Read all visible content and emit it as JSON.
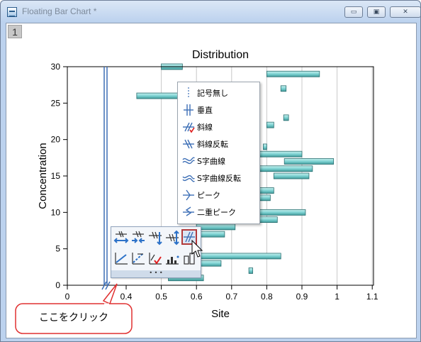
{
  "window": {
    "title": "Floating Bar Chart *",
    "buttons": {
      "minimize": "▭",
      "restore": "▣",
      "close": "✕"
    }
  },
  "layer_tab": "1",
  "chart_data": {
    "type": "bar",
    "orientation": "horizontal floating",
    "title": "Distribution",
    "xlabel": "Site",
    "ylabel": "Concentration",
    "xlim": [
      0,
      1.1
    ],
    "ylim": [
      0,
      30
    ],
    "x_tick_labels": [
      "0",
      "0.4",
      "0.5",
      "0.6",
      "0.7",
      "0.8",
      "0.9",
      "1",
      "1.1"
    ],
    "y_tick_labels": [
      "0",
      "5",
      "10",
      "15",
      "20",
      "25",
      "30"
    ],
    "axis_break": {
      "from": 0.05,
      "to": 0.35
    },
    "grid": "vertical",
    "bars": [
      {
        "y": 30,
        "start": 0.5,
        "end": 0.56
      },
      {
        "y": 29,
        "start": 0.8,
        "end": 0.95
      },
      {
        "y": 27,
        "start": 0.84,
        "end": 0.855
      },
      {
        "y": 26,
        "start": 0.43,
        "end": 0.57
      },
      {
        "y": 23,
        "start": 0.848,
        "end": 0.862
      },
      {
        "y": 22,
        "start": 0.8,
        "end": 0.82
      },
      {
        "y": 19,
        "start": 0.79,
        "end": 0.8
      },
      {
        "y": 18,
        "start": 0.74,
        "end": 0.9
      },
      {
        "y": 17,
        "start": 0.85,
        "end": 0.99
      },
      {
        "y": 16,
        "start": 0.73,
        "end": 0.93
      },
      {
        "y": 15,
        "start": 0.82,
        "end": 0.92
      },
      {
        "y": 13,
        "start": 0.71,
        "end": 0.82
      },
      {
        "y": 12,
        "start": 0.68,
        "end": 0.81
      },
      {
        "y": 10,
        "start": 0.74,
        "end": 0.91
      },
      {
        "y": 9,
        "start": 0.6,
        "end": 0.83
      },
      {
        "y": 8,
        "start": 0.6,
        "end": 0.71
      },
      {
        "y": 7,
        "start": 0.6,
        "end": 0.68
      },
      {
        "y": 4,
        "start": 0.6,
        "end": 0.84
      },
      {
        "y": 3,
        "start": 0.6,
        "end": 0.67
      },
      {
        "y": 2,
        "start": 0.749,
        "end": 0.76
      },
      {
        "y": 1,
        "start": 0.52,
        "end": 0.62
      }
    ]
  },
  "context_menu": {
    "items": [
      {
        "label": "記号無し",
        "icon": "no-symbol-icon"
      },
      {
        "label": "垂直",
        "icon": "vertical-break-icon"
      },
      {
        "label": "斜線",
        "icon": "slash-break-icon"
      },
      {
        "label": "斜線反転",
        "icon": "reverse-slash-break-icon"
      },
      {
        "label": "S字曲線",
        "icon": "s-curve-break-icon"
      },
      {
        "label": "S字曲線反転",
        "icon": "reverse-s-curve-break-icon"
      },
      {
        "label": "ピーク",
        "icon": "peak-break-icon"
      },
      {
        "label": "二重ピーク",
        "icon": "double-peak-break-icon"
      }
    ]
  },
  "mini_toolbar": {
    "grip": "• • •",
    "buttons": [
      "break-position-icon",
      "break-gap-icon",
      "break-direction-icon",
      "break-arrow-icon",
      "break-symbol-icon",
      "axis-line-icon",
      "axis-scale-icon",
      "axis-break-settings-icon",
      "tick-label-icon",
      "axis-more-icon"
    ]
  },
  "callout": {
    "text": "ここをクリック"
  },
  "colors": {
    "bar_fill": "#7fd3d3",
    "bar_stroke": "#2a6e70",
    "axis_break": "#3d6fb6",
    "callout_border": "#e03030"
  }
}
